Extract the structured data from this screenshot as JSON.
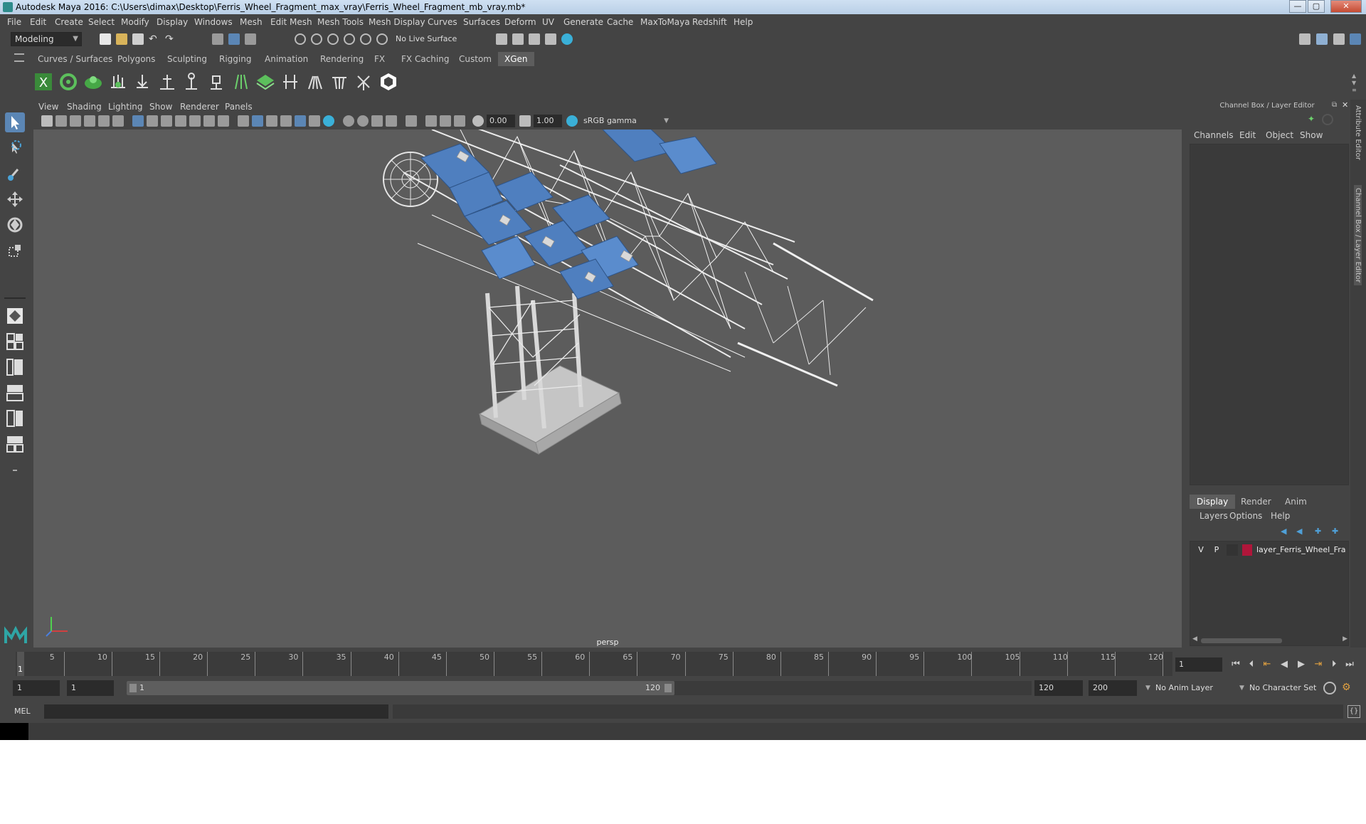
{
  "window": {
    "title": "Autodesk Maya 2016: C:\\Users\\dimax\\Desktop\\Ferris_Wheel_Fragment_max_vray\\Ferris_Wheel_Fragment_mb_vray.mb*",
    "controls": {
      "minimize": "—",
      "maximize": "▢",
      "close": "✕"
    }
  },
  "menubar": [
    "File",
    "Edit",
    "Create",
    "Select",
    "Modify",
    "Display",
    "Windows",
    "Mesh",
    "Edit Mesh",
    "Mesh Tools",
    "Mesh Display",
    "Curves",
    "Surfaces",
    "Deform",
    "UV",
    "Generate",
    "Cache",
    "MaxToMaya",
    "Redshift",
    "Help"
  ],
  "statusline": {
    "mode": "Modeling",
    "live_surface": "No Live Surface"
  },
  "shelf": {
    "tabs": [
      "Curves / Surfaces",
      "Polygons",
      "Sculpting",
      "Rigging",
      "Animation",
      "Rendering",
      "FX",
      "FX Caching",
      "Custom",
      "XGen"
    ],
    "active_tab": "XGen"
  },
  "panel": {
    "menu": [
      "View",
      "Shading",
      "Lighting",
      "Show",
      "Renderer",
      "Panels"
    ],
    "exposure": "0.00",
    "gamma": "1.00",
    "color_space": "sRGB gamma",
    "camera_label": "persp"
  },
  "channel_box": {
    "title": "Channel Box / Layer Editor",
    "menu": [
      "Channels",
      "Edit",
      "Object",
      "Show"
    ]
  },
  "layer_editor": {
    "tabs": [
      "Display",
      "Render",
      "Anim"
    ],
    "active_tab": "Display",
    "menu": [
      "Layers",
      "Options",
      "Help"
    ],
    "layers": [
      {
        "visible": "V",
        "playback": "P",
        "name": "layer_Ferris_Wheel_Fragi",
        "color": "#b0163a"
      }
    ]
  },
  "side_tabs": [
    "Attribute Editor",
    "Channel Box / Layer Editor"
  ],
  "timeline": {
    "ticks": [
      "5",
      "10",
      "15",
      "20",
      "25",
      "30",
      "35",
      "40",
      "45",
      "50",
      "55",
      "60",
      "65",
      "70",
      "75",
      "80",
      "85",
      "90",
      "95",
      "100",
      "105",
      "110",
      "115",
      "120"
    ],
    "first_frame": "1",
    "current_frame": "1"
  },
  "range": {
    "start": "1",
    "playback_start": "1",
    "slider_start": "1",
    "slider_end": "120",
    "playback_end": "120",
    "end": "200",
    "anim_layer": "No Anim Layer",
    "character_set": "No Character Set"
  },
  "command_line": {
    "label": "MEL"
  },
  "colors": {
    "accent": "#5b86b5",
    "model_blue": "#4f7fbf",
    "viewport_bg": "#5c5c5c"
  }
}
